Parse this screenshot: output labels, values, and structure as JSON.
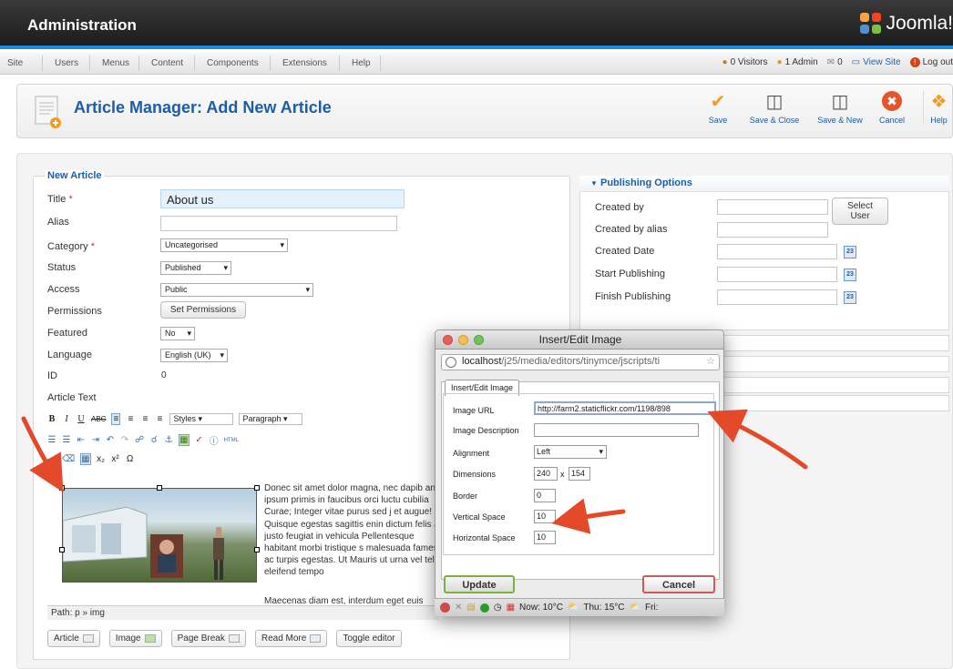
{
  "header": {
    "title": "Administration",
    "logo_text": "Joomla!"
  },
  "menu": [
    "Site",
    "Users",
    "Menus",
    "Content",
    "Components",
    "Extensions",
    "Help"
  ],
  "status": {
    "visitors": "0 Visitors",
    "admin": "1 Admin",
    "messages": "0",
    "view_site": "View Site",
    "logout": "Log out"
  },
  "toolbar": {
    "page_title": "Article Manager: Add New Article",
    "buttons": [
      "Save",
      "Save & Close",
      "Save & New",
      "Cancel",
      "Help"
    ]
  },
  "article": {
    "legend": "New Article",
    "labels": {
      "title": "Title",
      "alias": "Alias",
      "category": "Category",
      "status": "Status",
      "access": "Access",
      "permissions": "Permissions",
      "featured": "Featured",
      "language": "Language",
      "id": "ID",
      "article_text": "Article Text"
    },
    "required_mark": "*",
    "values": {
      "title": "About us",
      "alias": "",
      "category": "Uncategorised",
      "status": "Published",
      "access": "Public",
      "featured": "No",
      "language": "English (UK)",
      "id": "0"
    },
    "permissions_button": "Set Permissions"
  },
  "editor": {
    "styles": "Styles",
    "format": "Paragraph",
    "text_paragraph1": "Donec sit amet dolor magna, nec dapib ante ipsum primis in faucibus orci luctu cubilia Curae; Integer vitae purus sed j et augue! Quisque egestas sagittis enin dictum felis ac justo feugiat in vehicula Pellentesque habitant morbi tristique s malesuada fames ac turpis egestas. Ut Mauris ut urna vel tellus eleifend tempo",
    "text_paragraph2": "Maecenas diam est, interdum eget euis",
    "path": "Path: p » img",
    "bottom_buttons": [
      "Article",
      "Image",
      "Page Break",
      "Read More",
      "Toggle editor"
    ]
  },
  "publishing": {
    "heading": "Publishing Options",
    "labels": [
      "Created by",
      "Created by alias",
      "Created Date",
      "Start Publishing",
      "Finish Publishing"
    ],
    "select_user": "Select User",
    "calendar_num": "23"
  },
  "dialog": {
    "window_title": "Insert/Edit Image",
    "url_host": "localhost",
    "url_path": "/j25/media/editors/tinymce/jscripts/ti",
    "tab": "Insert/Edit Image",
    "labels": {
      "image_url": "Image URL",
      "description": "Image Description",
      "alignment": "Alignment",
      "dimensions": "Dimensions",
      "border": "Border",
      "vspace": "Vertical Space",
      "hspace": "Horizontal Space"
    },
    "values": {
      "image_url": "http://farm2.staticflickr.com/1198/898",
      "description": "",
      "alignment": "Left",
      "width": "240",
      "height": "154",
      "dim_sep": "x",
      "border": "0",
      "vspace": "10",
      "hspace": "10"
    },
    "update": "Update",
    "cancel": "Cancel",
    "statusbar": {
      "now": "Now: 10°C",
      "thu": "Thu: 15°C",
      "fri": "Fri:"
    }
  },
  "colors": {
    "brand_blue": "#1c5ea6",
    "header_dark": "#1c1c1c",
    "accent_stripe": "#1f8bd6",
    "arrow_red": "#e24a2a"
  }
}
